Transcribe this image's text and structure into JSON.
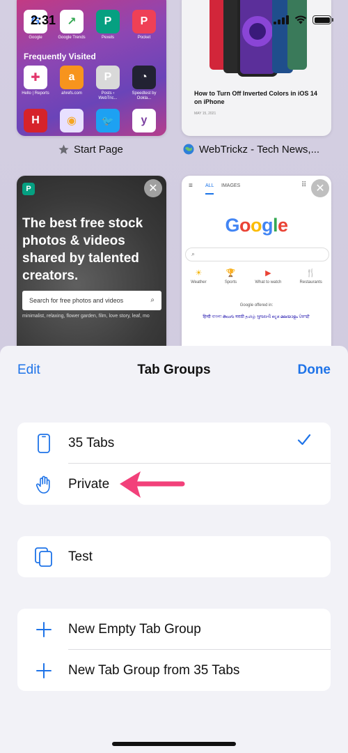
{
  "status_bar": {
    "time": "2:31"
  },
  "tabs": {
    "start_page": {
      "title": "Start Page",
      "top_sites": [
        {
          "label": "Google",
          "letter": "G",
          "color": "#ffffff"
        },
        {
          "label": "Google Trends",
          "letter": "↗",
          "color": "#ffffff"
        },
        {
          "label": "Pexels",
          "letter": "P",
          "color": "#05a081"
        },
        {
          "label": "Pocket",
          "letter": "P",
          "color": "#ef4056"
        }
      ],
      "frequently_visited_heading": "Frequently Visited",
      "frequently_visited": [
        {
          "label": "Hello | Reports",
          "letter": "✚",
          "color": "#ffffff"
        },
        {
          "label": "ahrefs.com",
          "letter": "a",
          "color": "#f7941d"
        },
        {
          "label": "Posts ‹ WebTric...",
          "letter": "P",
          "color": "#d9d9d9"
        },
        {
          "label": "Speedtest by Ookla...",
          "letter": "◔",
          "color": "#222233"
        },
        {
          "label": "",
          "letter": "H",
          "color": "#d6232a"
        },
        {
          "label": "",
          "letter": "◉",
          "color": "#e8e0ff"
        },
        {
          "label": "",
          "letter": "🐦",
          "color": "#1da1f2"
        },
        {
          "label": "",
          "letter": "y",
          "color": "#ffffff"
        }
      ]
    },
    "webtrickz": {
      "title": "WebTrickz - Tech News,...",
      "article_title": "How to Turn Off Inverted Colors in iOS 14 on iPhone",
      "article_date": "MAY 15, 2021"
    },
    "pexels": {
      "headline": "The best free stock photos & videos shared by talented creators.",
      "search_placeholder": "Search for free photos and videos",
      "tags": "minimalist, relaxing, flower garden, film, love story, leaf, mo"
    },
    "google": {
      "nav_all": "ALL",
      "nav_images": "IMAGES",
      "logo_text": "Google",
      "shortcuts": [
        {
          "label": "Weather",
          "icon": "☀"
        },
        {
          "label": "Sports",
          "icon": "🏆"
        },
        {
          "label": "What to watch",
          "icon": "▶"
        },
        {
          "label": "Restaurants",
          "icon": "🍴"
        }
      ],
      "offered_in": "Google offered in:",
      "languages": "हिन्दी  বাংলা  తెలుగు  मराठी  தமிழ்  ગુજરાતી  ಕನ್ನಡ  മലയാളം  ਪੰਜਾਬੀ"
    }
  },
  "sheet": {
    "edit_label": "Edit",
    "title": "Tab Groups",
    "done_label": "Done",
    "groups": [
      {
        "label": "35 Tabs",
        "icon": "phone-icon",
        "selected": true
      },
      {
        "label": "Private",
        "icon": "hand-icon",
        "selected": false
      }
    ],
    "custom_groups": [
      {
        "label": "Test",
        "icon": "tabs-icon"
      }
    ],
    "actions": [
      {
        "label": "New Empty Tab Group",
        "icon": "plus-icon"
      },
      {
        "label": "New Tab Group from 35 Tabs",
        "icon": "plus-icon"
      }
    ]
  },
  "colors": {
    "accent": "#1e73e8",
    "annotation_arrow": "#f2417a"
  }
}
